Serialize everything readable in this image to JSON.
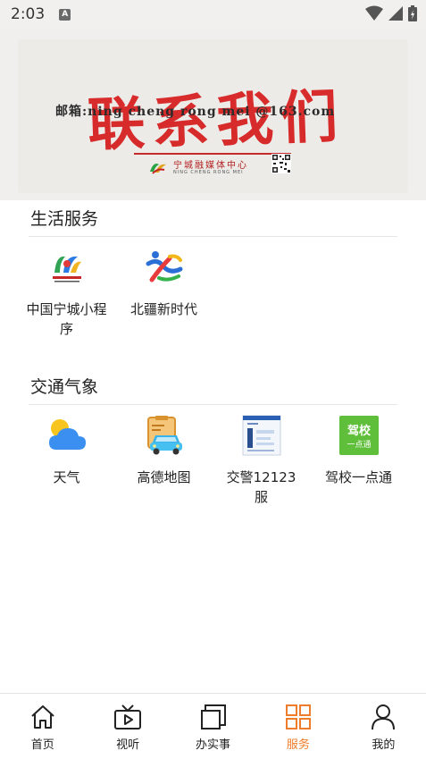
{
  "status_bar": {
    "time": "2:03",
    "notification": "A"
  },
  "banner": {
    "title": "联系我们",
    "email": "邮箱:ning cheng rong mei @163.com",
    "org_name": "宁城融媒体中心",
    "org_name_en": "NING CHENG RONG MEI"
  },
  "sections": [
    {
      "title": "生活服务",
      "items": [
        {
          "label": "中国宁城小程序",
          "icon": "ningcheng-logo-icon"
        },
        {
          "label": "北疆新时代",
          "icon": "beijiang-logo-icon"
        }
      ]
    },
    {
      "title": "交通气象",
      "items": [
        {
          "label": "天气",
          "icon": "weather-icon"
        },
        {
          "label": "高德地图",
          "icon": "amap-icon"
        },
        {
          "label": "交警12123服",
          "icon": "traffic-police-icon"
        },
        {
          "label": "驾校一点通",
          "icon": "driving-school-icon"
        }
      ]
    }
  ],
  "driving_school_badge": {
    "top": "驾校",
    "bottom": "一点通"
  },
  "bottom_nav": [
    {
      "label": "首页",
      "icon": "home-icon"
    },
    {
      "label": "视听",
      "icon": "tv-play-icon"
    },
    {
      "label": "办实事",
      "icon": "stack-icon"
    },
    {
      "label": "服务",
      "icon": "grid-icon",
      "active": true
    },
    {
      "label": "我的",
      "icon": "person-icon"
    }
  ],
  "colors": {
    "accent": "#ee7c2b",
    "banner_red": "#d61b1b",
    "weather_blue": "#3b8ff0",
    "driving_green": "#5fbf3a"
  }
}
